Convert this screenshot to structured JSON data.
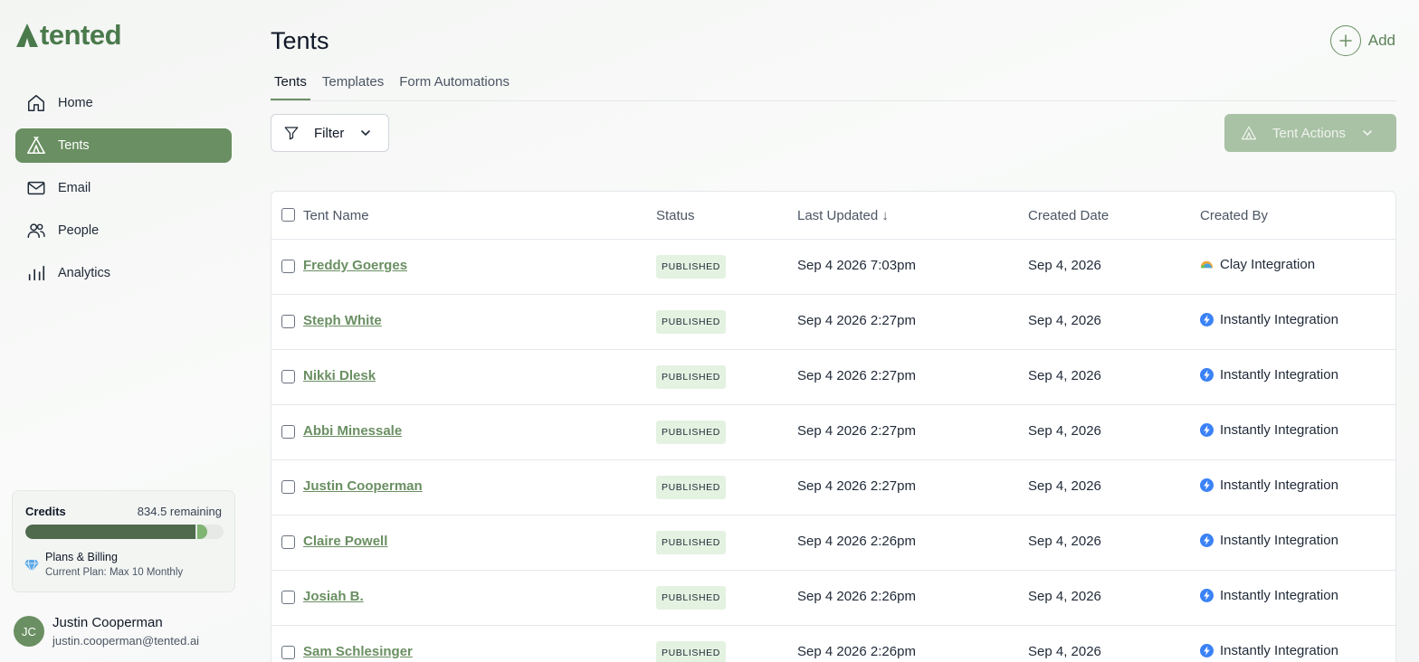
{
  "app": {
    "logo_text": "tented",
    "brand_color": "#6a8f62"
  },
  "sidebar": {
    "items": [
      {
        "label": "Home",
        "icon": "home-icon",
        "active": false
      },
      {
        "label": "Tents",
        "icon": "tent-icon",
        "active": true
      },
      {
        "label": "Email",
        "icon": "mail-icon",
        "active": false
      },
      {
        "label": "People",
        "icon": "people-icon",
        "active": false
      },
      {
        "label": "Analytics",
        "icon": "analytics-icon",
        "active": false
      }
    ],
    "credits": {
      "label": "Credits",
      "remaining": "834.5 remaining",
      "used_fraction": 0.87,
      "plans_title": "Plans & Billing",
      "plans_sub": "Current Plan: Max 10 Monthly"
    },
    "user": {
      "initials": "JC",
      "name": "Justin Cooperman",
      "email": "justin.cooperman@tented.ai"
    }
  },
  "header": {
    "title": "Tents",
    "add_label": "Add",
    "tabs": [
      "Tents",
      "Templates",
      "Form Automations"
    ],
    "active_tab": 0
  },
  "toolbar": {
    "filter_label": "Filter",
    "actions_label": "Tent Actions"
  },
  "table": {
    "columns": [
      "Tent Name",
      "Status",
      "Last Updated ↓",
      "Created Date",
      "Created By"
    ],
    "rows": [
      {
        "name": "Freddy Goerges",
        "status": "PUBLISHED",
        "updated": "Sep 4 2026 7:03pm",
        "created": "Sep 4, 2026",
        "by": "Clay Integration",
        "by_icon": "clay-icon"
      },
      {
        "name": "Steph White",
        "status": "PUBLISHED",
        "updated": "Sep 4 2026 2:27pm",
        "created": "Sep 4, 2026",
        "by": "Instantly Integration",
        "by_icon": "lightning-icon"
      },
      {
        "name": "Nikki Dlesk",
        "status": "PUBLISHED",
        "updated": "Sep 4 2026 2:27pm",
        "created": "Sep 4, 2026",
        "by": "Instantly Integration",
        "by_icon": "lightning-icon"
      },
      {
        "name": "Abbi Minessale",
        "status": "PUBLISHED",
        "updated": "Sep 4 2026 2:27pm",
        "created": "Sep 4, 2026",
        "by": "Instantly Integration",
        "by_icon": "lightning-icon"
      },
      {
        "name": "Justin Cooperman",
        "status": "PUBLISHED",
        "updated": "Sep 4 2026 2:27pm",
        "created": "Sep 4, 2026",
        "by": "Instantly Integration",
        "by_icon": "lightning-icon"
      },
      {
        "name": "Claire Powell",
        "status": "PUBLISHED",
        "updated": "Sep 4 2026 2:26pm",
        "created": "Sep 4, 2026",
        "by": "Instantly Integration",
        "by_icon": "lightning-icon"
      },
      {
        "name": "Josiah B.",
        "status": "PUBLISHED",
        "updated": "Sep 4 2026 2:26pm",
        "created": "Sep 4, 2026",
        "by": "Instantly Integration",
        "by_icon": "lightning-icon"
      },
      {
        "name": "Sam Schlesinger",
        "status": "PUBLISHED",
        "updated": "Sep 4 2026 2:26pm",
        "created": "Sep 4, 2026",
        "by": "Instantly Integration",
        "by_icon": "lightning-icon"
      }
    ]
  }
}
